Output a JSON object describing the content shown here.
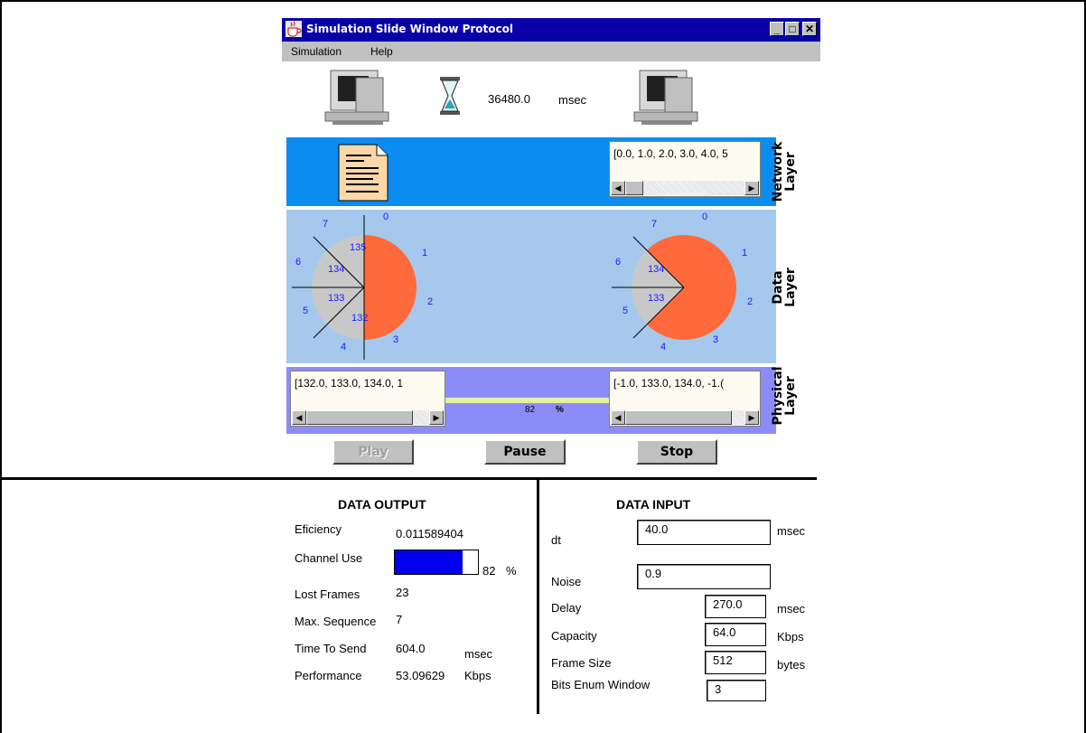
{
  "window": {
    "title": "Simulation Slide Window Protocol",
    "menu": [
      "Simulation",
      "Help"
    ],
    "controls": {
      "minimize": "_",
      "maximize": "□",
      "close": "✕"
    }
  },
  "timer": {
    "value": "36480.0",
    "unit": "msec"
  },
  "layers": {
    "network": {
      "label_line1": "Network",
      "label_line2": "Layer",
      "receiver_text": "[0.0, 1.0, 2.0, 3.0, 4.0, 5",
      "color": "#0a8cf0"
    },
    "data": {
      "label_line1": "Data",
      "label_line2": "Layer",
      "color": "#a6c8ec",
      "sender": {
        "positions": [
          "0",
          "1",
          "2",
          "3",
          "4",
          "5",
          "6",
          "7"
        ],
        "frames": [
          "135",
          "134",
          "133",
          "132"
        ]
      },
      "receiver": {
        "positions": [
          "0",
          "1",
          "2",
          "3",
          "4",
          "5",
          "6",
          "7"
        ],
        "frames": [
          "134",
          "133"
        ]
      },
      "window_color": "#ff6a3c",
      "frame_color": "#c8c8c8"
    },
    "physical": {
      "label_line1": "Physical",
      "label_line2": "Layer",
      "sender_text": "[132.0, 133.0, 134.0, 1",
      "receiver_text": "[-1.0, 133.0, 134.0, -1.(",
      "channel_percent": "82",
      "percent_sign": "%",
      "color": "#8c8cf8"
    }
  },
  "buttons": {
    "play": "Play",
    "pause": "Pause",
    "stop": "Stop"
  },
  "output": {
    "title": "DATA OUTPUT",
    "efficiency_label": "Eficiency",
    "efficiency_value": "0.011589404",
    "channel_use_label": "Channel Use",
    "channel_use_value": "82",
    "channel_use_fraction": 0.82,
    "channel_use_unit": "%",
    "lost_frames_label": "Lost Frames",
    "lost_frames_value": "23",
    "max_sequence_label": "Max. Sequence",
    "max_sequence_value": "7",
    "time_to_send_label": "Time To Send",
    "time_to_send_value": "604.0",
    "time_to_send_unit": "msec",
    "performance_label": "Performance",
    "performance_value": "53.09629",
    "performance_unit": "Kbps"
  },
  "input": {
    "title": "DATA INPUT",
    "dt_label": "dt",
    "dt_value": "40.0",
    "dt_unit": "msec",
    "noise_label": "Noise",
    "noise_value": "0.9",
    "delay_label": "Delay",
    "delay_value": "270.0",
    "delay_unit": "msec",
    "capacity_label": "Capacity",
    "capacity_value": "64.0",
    "capacity_unit": "Kbps",
    "frame_size_label": "Frame Size",
    "frame_size_value": "512",
    "frame_size_unit": "bytes",
    "bits_label": "Bits Enum Window",
    "bits_value": "3"
  }
}
